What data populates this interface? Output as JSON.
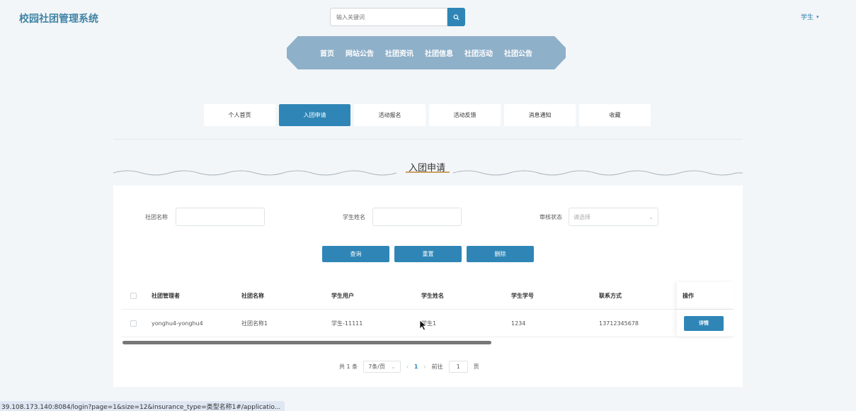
{
  "header": {
    "logo": "校园社团管理系统",
    "search_placeholder": "输入关键词",
    "user_label": "学生"
  },
  "nav": {
    "items": [
      "首页",
      "网站公告",
      "社团资讯",
      "社团信息",
      "社团活动",
      "社团公告"
    ]
  },
  "tabs": {
    "items": [
      "个人首页",
      "入团申请",
      "活动报名",
      "活动反馈",
      "消息通知",
      "收藏"
    ],
    "active_index": 1
  },
  "section": {
    "title": "入团申请"
  },
  "filters": {
    "club_name_label": "社团名称",
    "student_name_label": "学生姓名",
    "status_label": "审核状态",
    "status_placeholder": "请选择"
  },
  "buttons": {
    "search": "查询",
    "reset": "重置",
    "delete": "删除"
  },
  "table": {
    "columns": [
      "社团管理者",
      "社团名称",
      "学生用户",
      "学生姓名",
      "学生学号",
      "联系方式",
      "操作"
    ],
    "rows": [
      {
        "manager": "yonghu4-yonghu4",
        "club": "社团名称1",
        "user": "学生-11111",
        "name": "学生1",
        "student_no": "1234",
        "phone": "13712345678",
        "action": "详情"
      }
    ]
  },
  "pagination": {
    "total_text": "共 1 条",
    "page_size": "7条/页",
    "current_page": "1",
    "goto_label": "前往",
    "goto_value": "1",
    "page_suffix": "页"
  },
  "status_bar": {
    "url": "39.108.173.140:8084/login?page=1&size=12&insurance_type=类型名称1#/applicatio..."
  },
  "colors": {
    "primary": "#2f86b6",
    "nav_bg": "#8fb0c9",
    "logo": "#3f83a6"
  }
}
